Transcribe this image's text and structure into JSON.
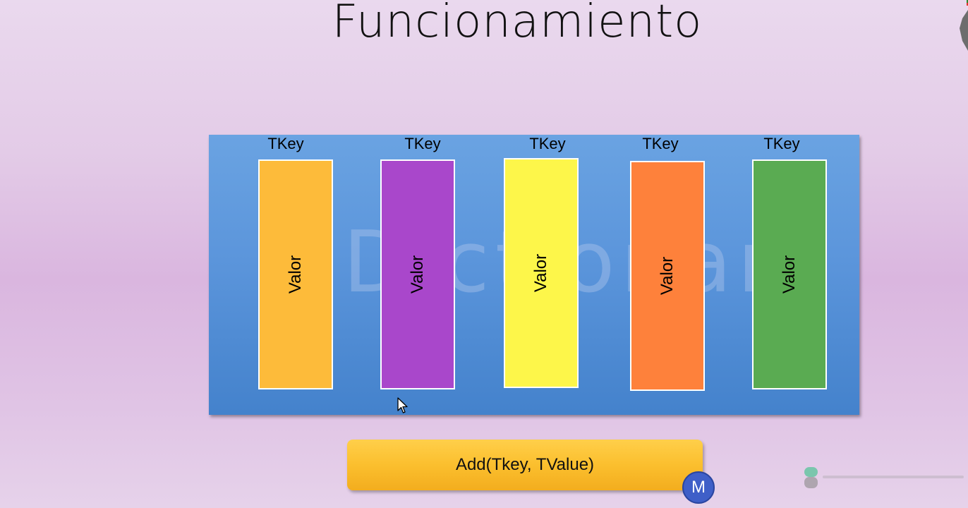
{
  "slide": {
    "title": "Funcionamiento"
  },
  "diagram": {
    "watermark_text": "Dictionary",
    "items": [
      {
        "key_label": "TKey",
        "value_label": "Valor",
        "color": "#fdbb3a"
      },
      {
        "key_label": "TKey",
        "value_label": "Valor",
        "color": "#a947cb"
      },
      {
        "key_label": "TKey",
        "value_label": "Valor",
        "color": "#fdf64a"
      },
      {
        "key_label": "TKey",
        "value_label": "Valor",
        "color": "#fe813b"
      },
      {
        "key_label": "TKey",
        "value_label": "Valor",
        "color": "#5aab52"
      }
    ],
    "box_color": "#5b95db"
  },
  "method": {
    "label": "Add(Tkey, TValue)",
    "color": "#fbbf2e"
  },
  "badge": {
    "letter": "M",
    "color": "#3f5fc8"
  },
  "icons": {
    "cursor": "mouse-pointer-icon",
    "logo": "brand-logo-icon"
  }
}
